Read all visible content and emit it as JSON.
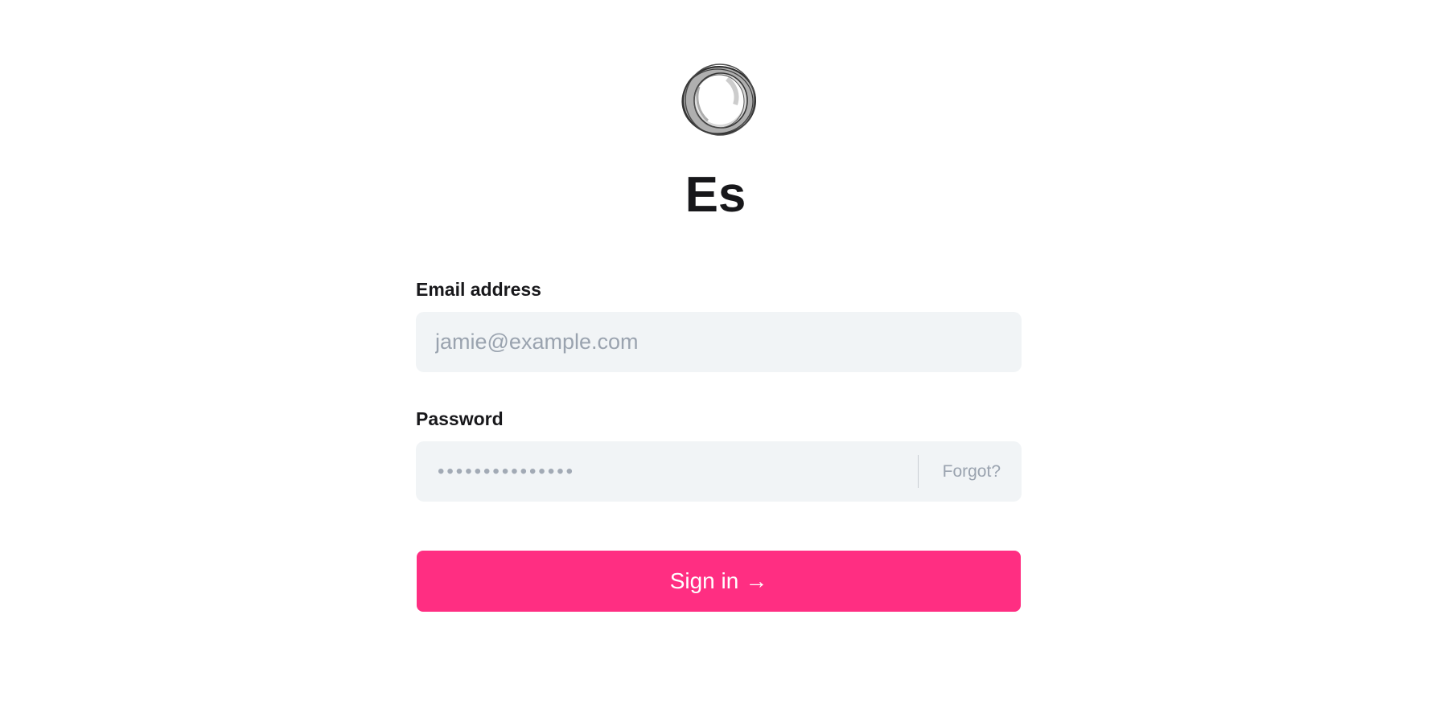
{
  "app": {
    "title": "Es"
  },
  "logo": {
    "icon": "ring-logo-icon"
  },
  "form": {
    "email": {
      "label": "Email address",
      "placeholder": "jamie@example.com",
      "value": ""
    },
    "password": {
      "label": "Password",
      "masked_value": "•••••••••••••••",
      "forgot_label": "Forgot?"
    },
    "submit": {
      "label": "Sign in",
      "icon": "→"
    }
  },
  "colors": {
    "accent": "#ff2e82",
    "input_background": "#f1f4f6",
    "placeholder": "#9aa3af"
  }
}
